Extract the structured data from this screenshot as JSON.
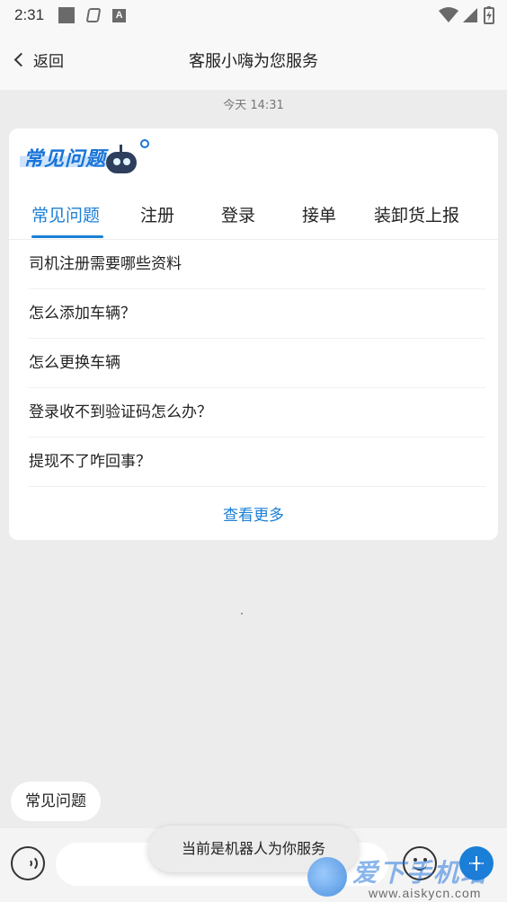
{
  "status_bar": {
    "time": "2:31",
    "icons": [
      "notification-square-icon",
      "drive-icon",
      "a-app-icon",
      "wifi-icon",
      "signal-icon",
      "battery-charging-icon"
    ]
  },
  "header": {
    "back_label": "返回",
    "title": "客服小嗨为您服务"
  },
  "chat": {
    "timestamp": "今天  14:31"
  },
  "faq_card": {
    "banner_text": "常见问题",
    "tabs": [
      {
        "label": "常见问题",
        "active": true
      },
      {
        "label": "注册",
        "active": false
      },
      {
        "label": "登录",
        "active": false
      },
      {
        "label": "接单",
        "active": false
      },
      {
        "label": "装卸货上报",
        "active": false
      }
    ],
    "questions": [
      "司机注册需要哪些资料",
      "怎么添加车辆？",
      "怎么更换车辆",
      "登录收不到验证码怎么办？",
      "提现不了咋回事？"
    ],
    "more_label": "查看更多"
  },
  "quick_chip": {
    "label": "常见问题"
  },
  "toast": {
    "text": "当前是机器人为你服务"
  },
  "watermark": {
    "text": "爱下手机站",
    "url": "www.aiskycn.com"
  },
  "colors": {
    "accent": "#1a7fd6",
    "background": "#ececec",
    "card": "#ffffff"
  }
}
